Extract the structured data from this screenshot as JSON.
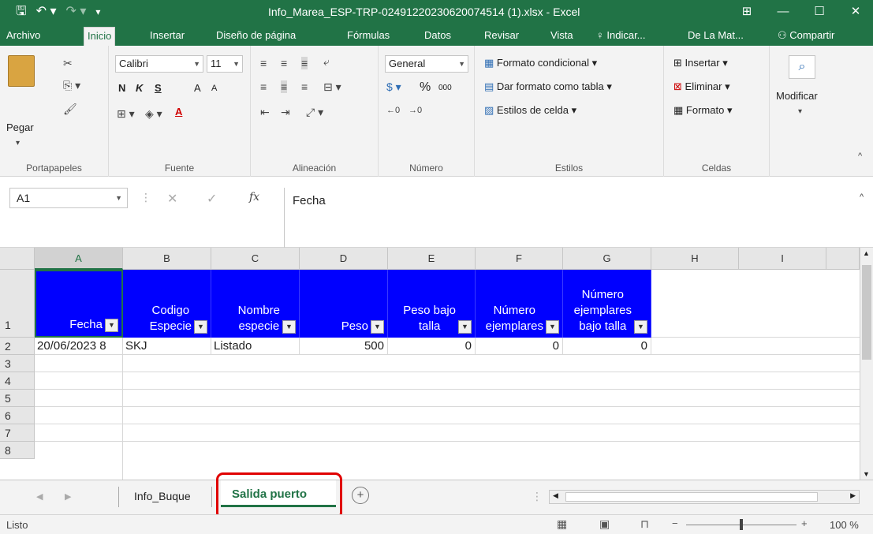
{
  "window": {
    "title": "Info_Marea_ESP-TRP-02491220230620074514 (1).xlsx - Excel",
    "save_icon": "save-icon",
    "undo_icon": "undo-icon",
    "redo_icon": "redo-icon"
  },
  "tabs": [
    "Archivo",
    "Inicio",
    "Insertar",
    "Diseño de página",
    "Fórmulas",
    "Datos",
    "Revisar",
    "Vista"
  ],
  "tell_me": "Indicar...",
  "user": "De La Mat...",
  "share": "Compartir",
  "ribbon": {
    "clipboard": {
      "paste": "Pegar",
      "label": "Portapapeles"
    },
    "font": {
      "name": "Calibri",
      "size": "11",
      "bold": "N",
      "italic": "K",
      "underline": "S",
      "grow": "A",
      "shrink": "A",
      "color_letter": "A",
      "label": "Fuente"
    },
    "alignment": {
      "label": "Alineación"
    },
    "number": {
      "format": "General",
      "percent": "%",
      "thousands": "000",
      "label": "Número"
    },
    "styles": {
      "conditional": "Formato condicional",
      "table": "Dar formato como tabla",
      "cell_styles": "Estilos de celda",
      "label": "Estilos"
    },
    "cells": {
      "insert": "Insertar",
      "delete": "Eliminar",
      "format": "Formato",
      "label": "Celdas"
    },
    "editing": {
      "modify": "Modificar"
    }
  },
  "formula_bar": {
    "name_box": "A1",
    "fx": "fx",
    "value": "Fecha"
  },
  "columns": [
    "A",
    "B",
    "C",
    "D",
    "E",
    "F",
    "G",
    "H",
    "I"
  ],
  "rows": [
    "1",
    "2",
    "3",
    "4",
    "5",
    "6",
    "7",
    "8"
  ],
  "table": {
    "headers": [
      [
        "Fecha"
      ],
      [
        "Codigo",
        "Especie"
      ],
      [
        "Nombre",
        "especie"
      ],
      [
        "Peso"
      ],
      [
        "Peso bajo",
        "talla"
      ],
      [
        "Número",
        "ejemplares"
      ],
      [
        "Número",
        "ejemplares",
        "bajo talla"
      ]
    ],
    "row2": [
      "20/06/2023 8",
      "SKJ",
      "Listado",
      "500",
      "0",
      "0",
      "0"
    ]
  },
  "sheets": {
    "tab1": "Info_Buque",
    "tab2": "Salida puerto",
    "add": "+"
  },
  "status": {
    "ready": "Listo",
    "zoom": "100 %",
    "zoom_level": 100
  },
  "colors": {
    "excel_green": "#217346",
    "header_fill": "#0000FF",
    "highlight_red": "#E00000"
  }
}
